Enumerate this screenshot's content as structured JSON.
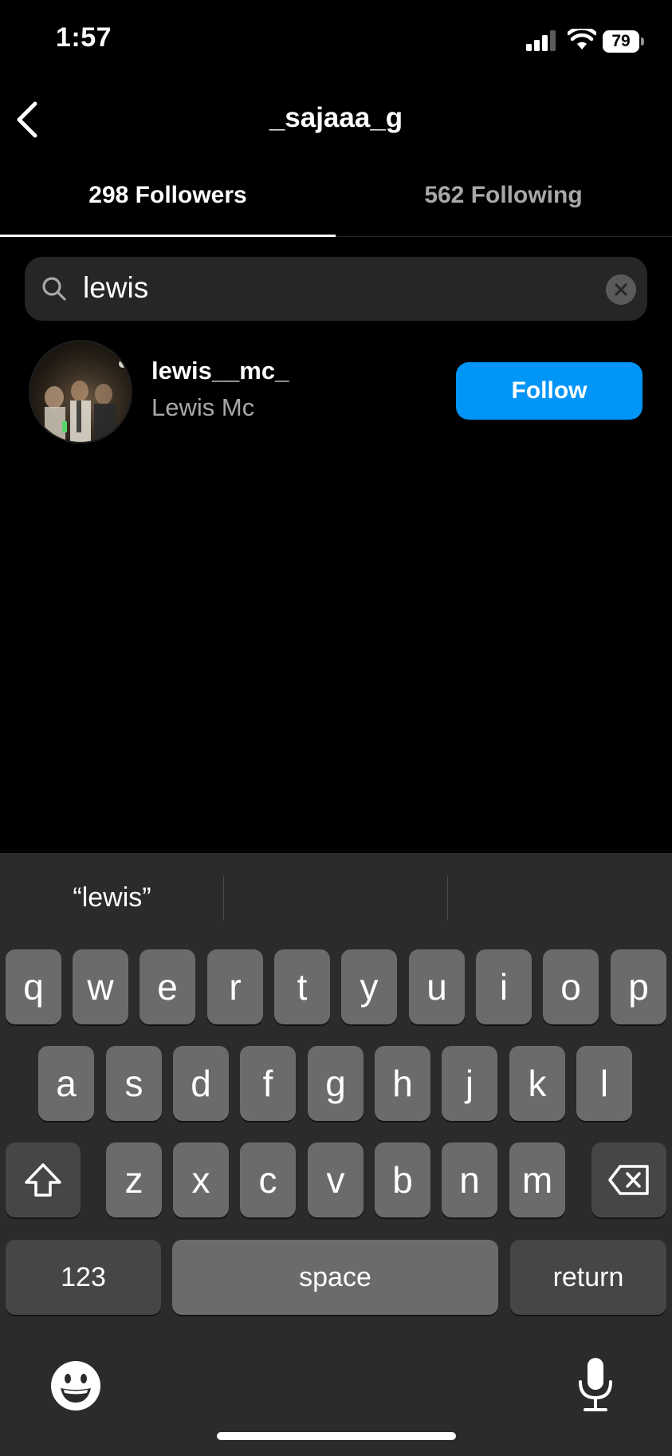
{
  "status": {
    "time": "1:57",
    "battery": "79"
  },
  "header": {
    "title": "_sajaaa_g"
  },
  "tabs": {
    "followers": "298 Followers",
    "following": "562 Following"
  },
  "search": {
    "value": "lewis"
  },
  "results": [
    {
      "username": "lewis__mc_",
      "fullname": "Lewis Mc",
      "button": "Follow"
    }
  ],
  "keyboard": {
    "suggestion": "“lewis”",
    "row1": [
      "q",
      "w",
      "e",
      "r",
      "t",
      "y",
      "u",
      "i",
      "o",
      "p"
    ],
    "row2": [
      "a",
      "s",
      "d",
      "f",
      "g",
      "h",
      "j",
      "k",
      "l"
    ],
    "row3": [
      "z",
      "x",
      "c",
      "v",
      "b",
      "n",
      "m"
    ],
    "numbers_label": "123",
    "space_label": "space",
    "return_label": "return"
  },
  "colors": {
    "accent": "#0095f6",
    "background": "#000000",
    "keyboard": "#2b2b2b"
  }
}
